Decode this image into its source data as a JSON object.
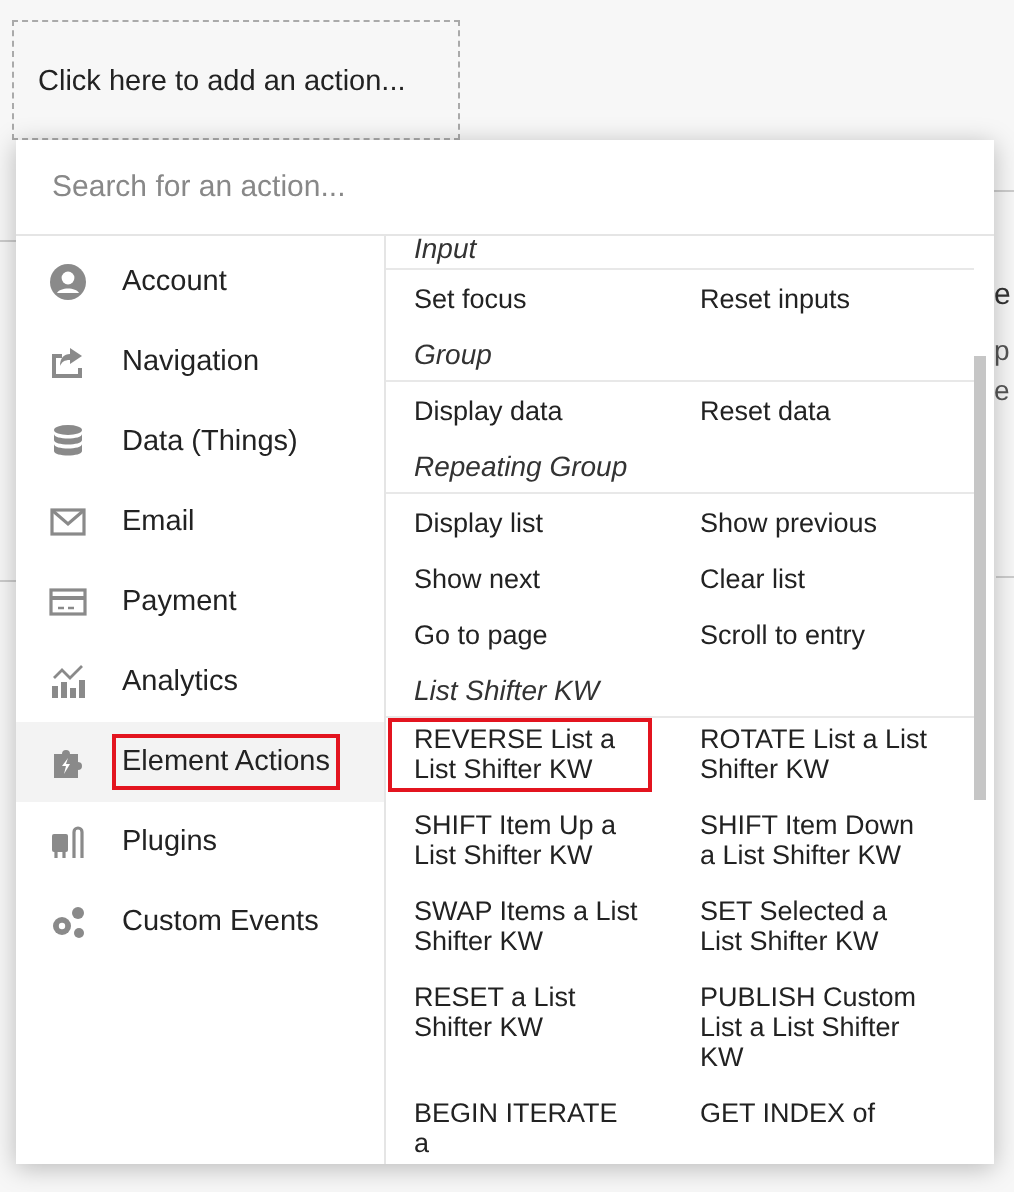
{
  "add_action": {
    "label": "Click here to add an action..."
  },
  "background_fragments": [
    {
      "text": "e"
    },
    {
      "text": "p"
    },
    {
      "text": "e"
    }
  ],
  "search": {
    "placeholder": "Search for an action..."
  },
  "categories": [
    {
      "label": "Account",
      "selected": false,
      "highlighted": false
    },
    {
      "label": "Navigation",
      "selected": false,
      "highlighted": false
    },
    {
      "label": "Data (Things)",
      "selected": false,
      "highlighted": false
    },
    {
      "label": "Email",
      "selected": false,
      "highlighted": false
    },
    {
      "label": "Payment",
      "selected": false,
      "highlighted": false
    },
    {
      "label": "Analytics",
      "selected": false,
      "highlighted": false
    },
    {
      "label": "Element Actions",
      "selected": true,
      "highlighted": true
    },
    {
      "label": "Plugins",
      "selected": false,
      "highlighted": false
    },
    {
      "label": "Custom Events",
      "selected": false,
      "highlighted": false
    }
  ],
  "groups": [
    {
      "title": "Input",
      "actions": [
        {
          "label": "Set focus",
          "highlighted": false
        },
        {
          "label": "Reset inputs",
          "highlighted": false
        }
      ]
    },
    {
      "title": "Group",
      "actions": [
        {
          "label": "Display data",
          "highlighted": false
        },
        {
          "label": "Reset data",
          "highlighted": false
        }
      ]
    },
    {
      "title": "Repeating Group",
      "actions": [
        {
          "label": "Display list",
          "highlighted": false
        },
        {
          "label": "Show previous",
          "highlighted": false
        },
        {
          "label": "Show next",
          "highlighted": false
        },
        {
          "label": "Clear list",
          "highlighted": false
        },
        {
          "label": "Go to page",
          "highlighted": false
        },
        {
          "label": "Scroll to entry",
          "highlighted": false
        }
      ]
    },
    {
      "title": "List Shifter KW",
      "actions": [
        {
          "label": "REVERSE List a List Shifter KW",
          "highlighted": true
        },
        {
          "label": "ROTATE List a List Shifter KW",
          "highlighted": false
        },
        {
          "label": "SHIFT Item Up a List Shifter KW",
          "highlighted": false
        },
        {
          "label": "SHIFT Item Down a List Shifter KW",
          "highlighted": false
        },
        {
          "label": "SWAP Items a List Shifter KW",
          "highlighted": false
        },
        {
          "label": "SET Selected a List Shifter KW",
          "highlighted": false
        },
        {
          "label": "RESET a List Shifter KW",
          "highlighted": false
        },
        {
          "label": "PUBLISH Custom List a List Shifter KW",
          "highlighted": false
        },
        {
          "label": "BEGIN ITERATE a",
          "highlighted": false
        },
        {
          "label": "GET INDEX of",
          "highlighted": false
        }
      ]
    }
  ]
}
